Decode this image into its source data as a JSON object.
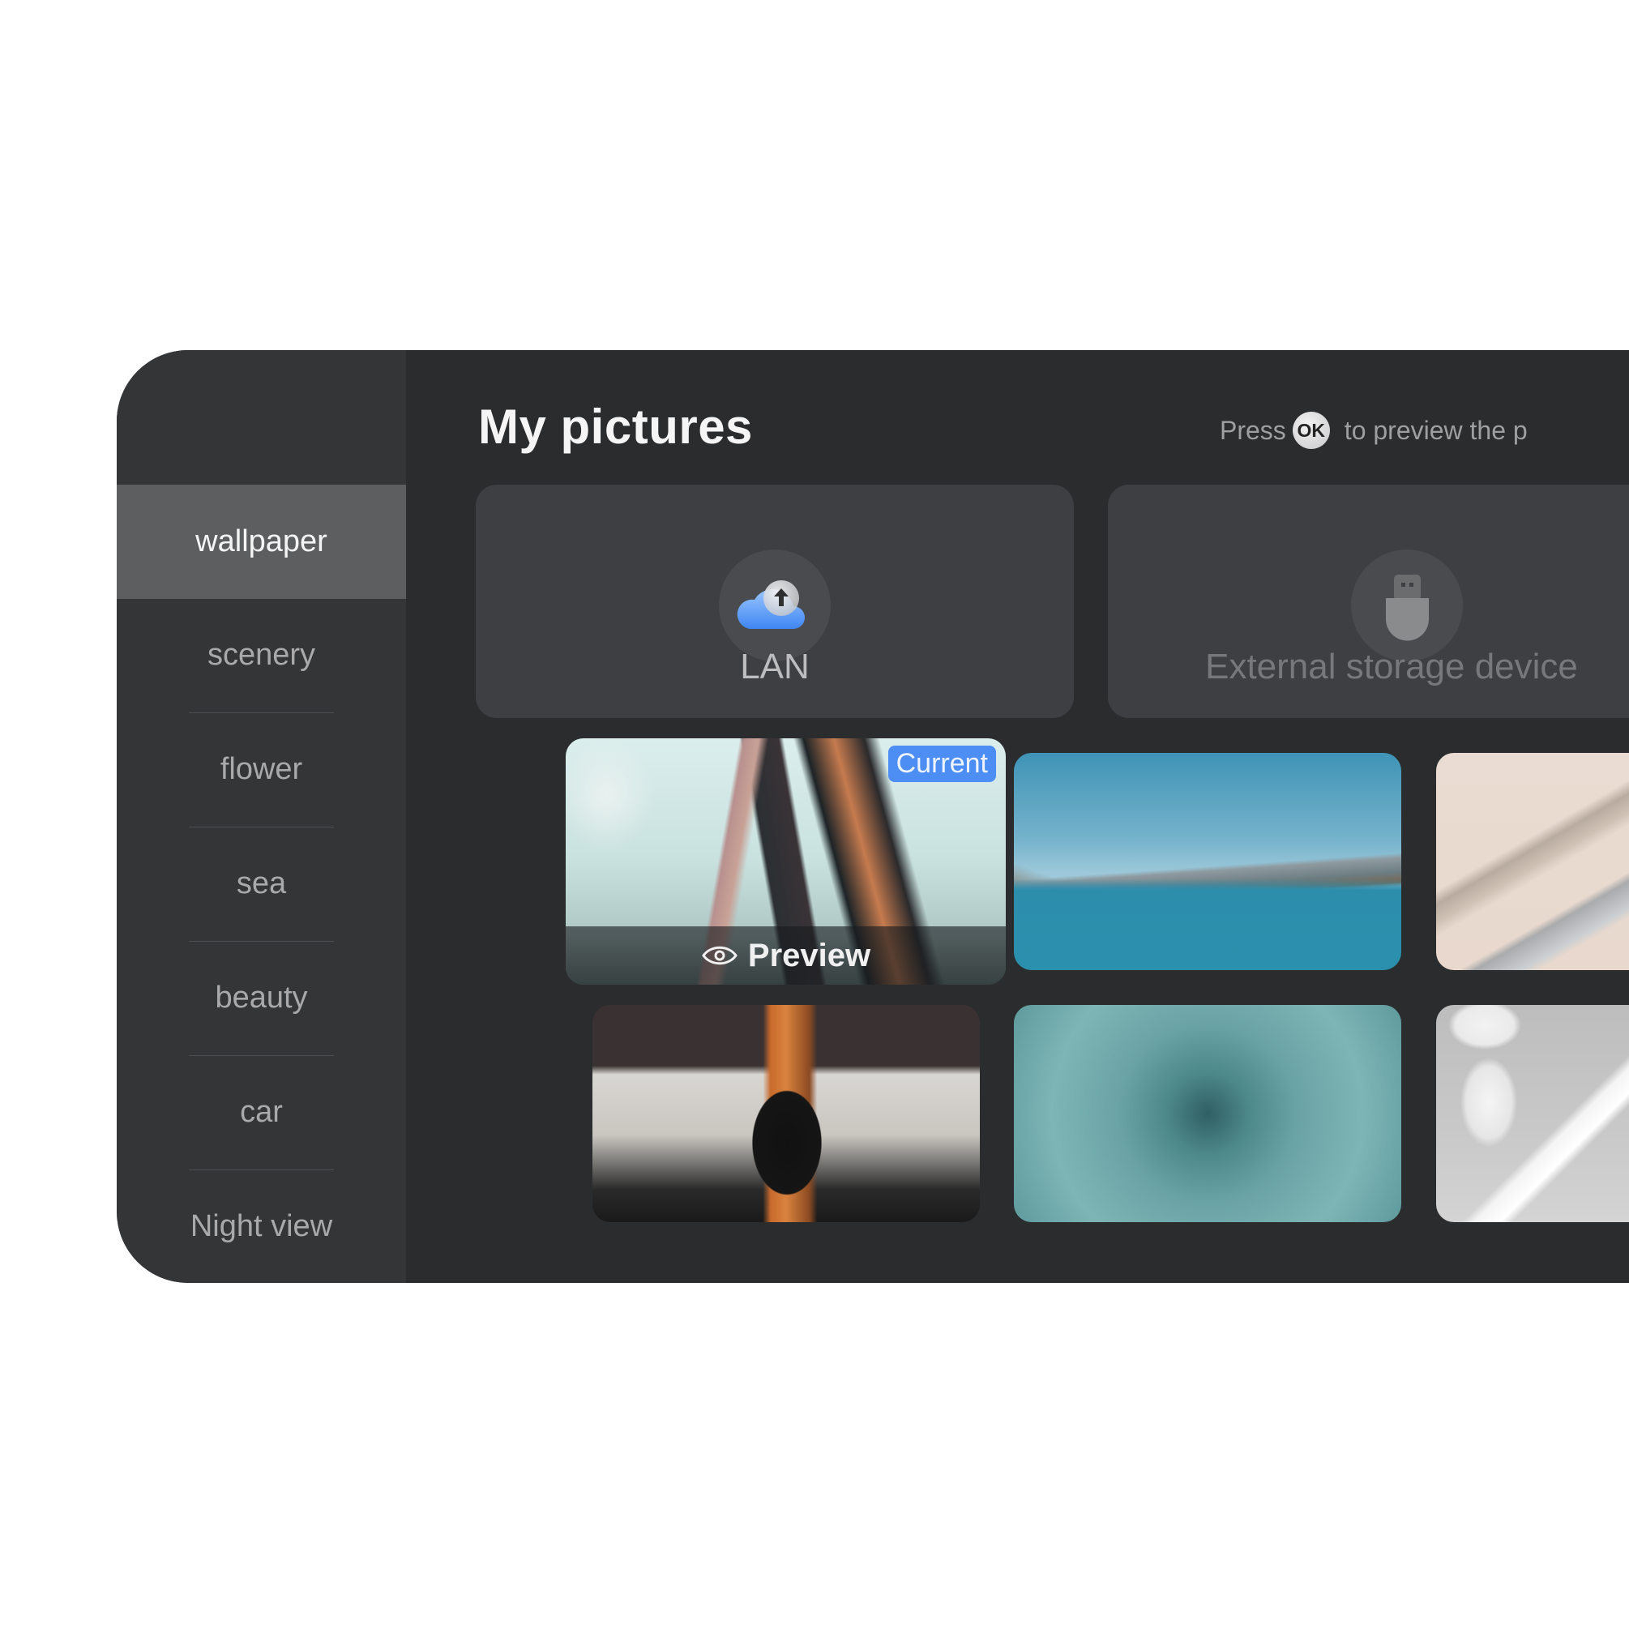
{
  "sidebar": {
    "items": [
      {
        "label": "wallpaper",
        "active": true
      },
      {
        "label": "scenery",
        "active": false
      },
      {
        "label": "flower",
        "active": false
      },
      {
        "label": "sea",
        "active": false
      },
      {
        "label": "beauty",
        "active": false
      },
      {
        "label": "car",
        "active": false
      },
      {
        "label": "Night view",
        "active": false
      }
    ]
  },
  "header": {
    "title": "My pictures",
    "hint_prefix": "Press",
    "hint_key": "OK",
    "hint_suffix": "to preview the p"
  },
  "sources": [
    {
      "label": "LAN",
      "icon": "cloud-upload-icon"
    },
    {
      "label": "External storage device",
      "icon": "usb-drive-icon"
    }
  ],
  "gallery": {
    "current_badge": "Current",
    "preview_label": "Preview",
    "tiles": [
      {
        "subject": "makeup brushes in glass jars",
        "current": true,
        "focused": true
      },
      {
        "subject": "sea coast with rocky island"
      },
      {
        "subject": "cosmetic bottle on rope"
      },
      {
        "subject": "makeup brush holder on desk"
      },
      {
        "subject": "agave succulent"
      },
      {
        "subject": "jade face roller with stones"
      }
    ]
  },
  "colors": {
    "accent": "#4d8ef4",
    "panel_bg": "#2b2c2e",
    "sidebar_bg": "#343537",
    "sidebar_active": "#5d5e60",
    "card_bg": "#3e3f42"
  }
}
